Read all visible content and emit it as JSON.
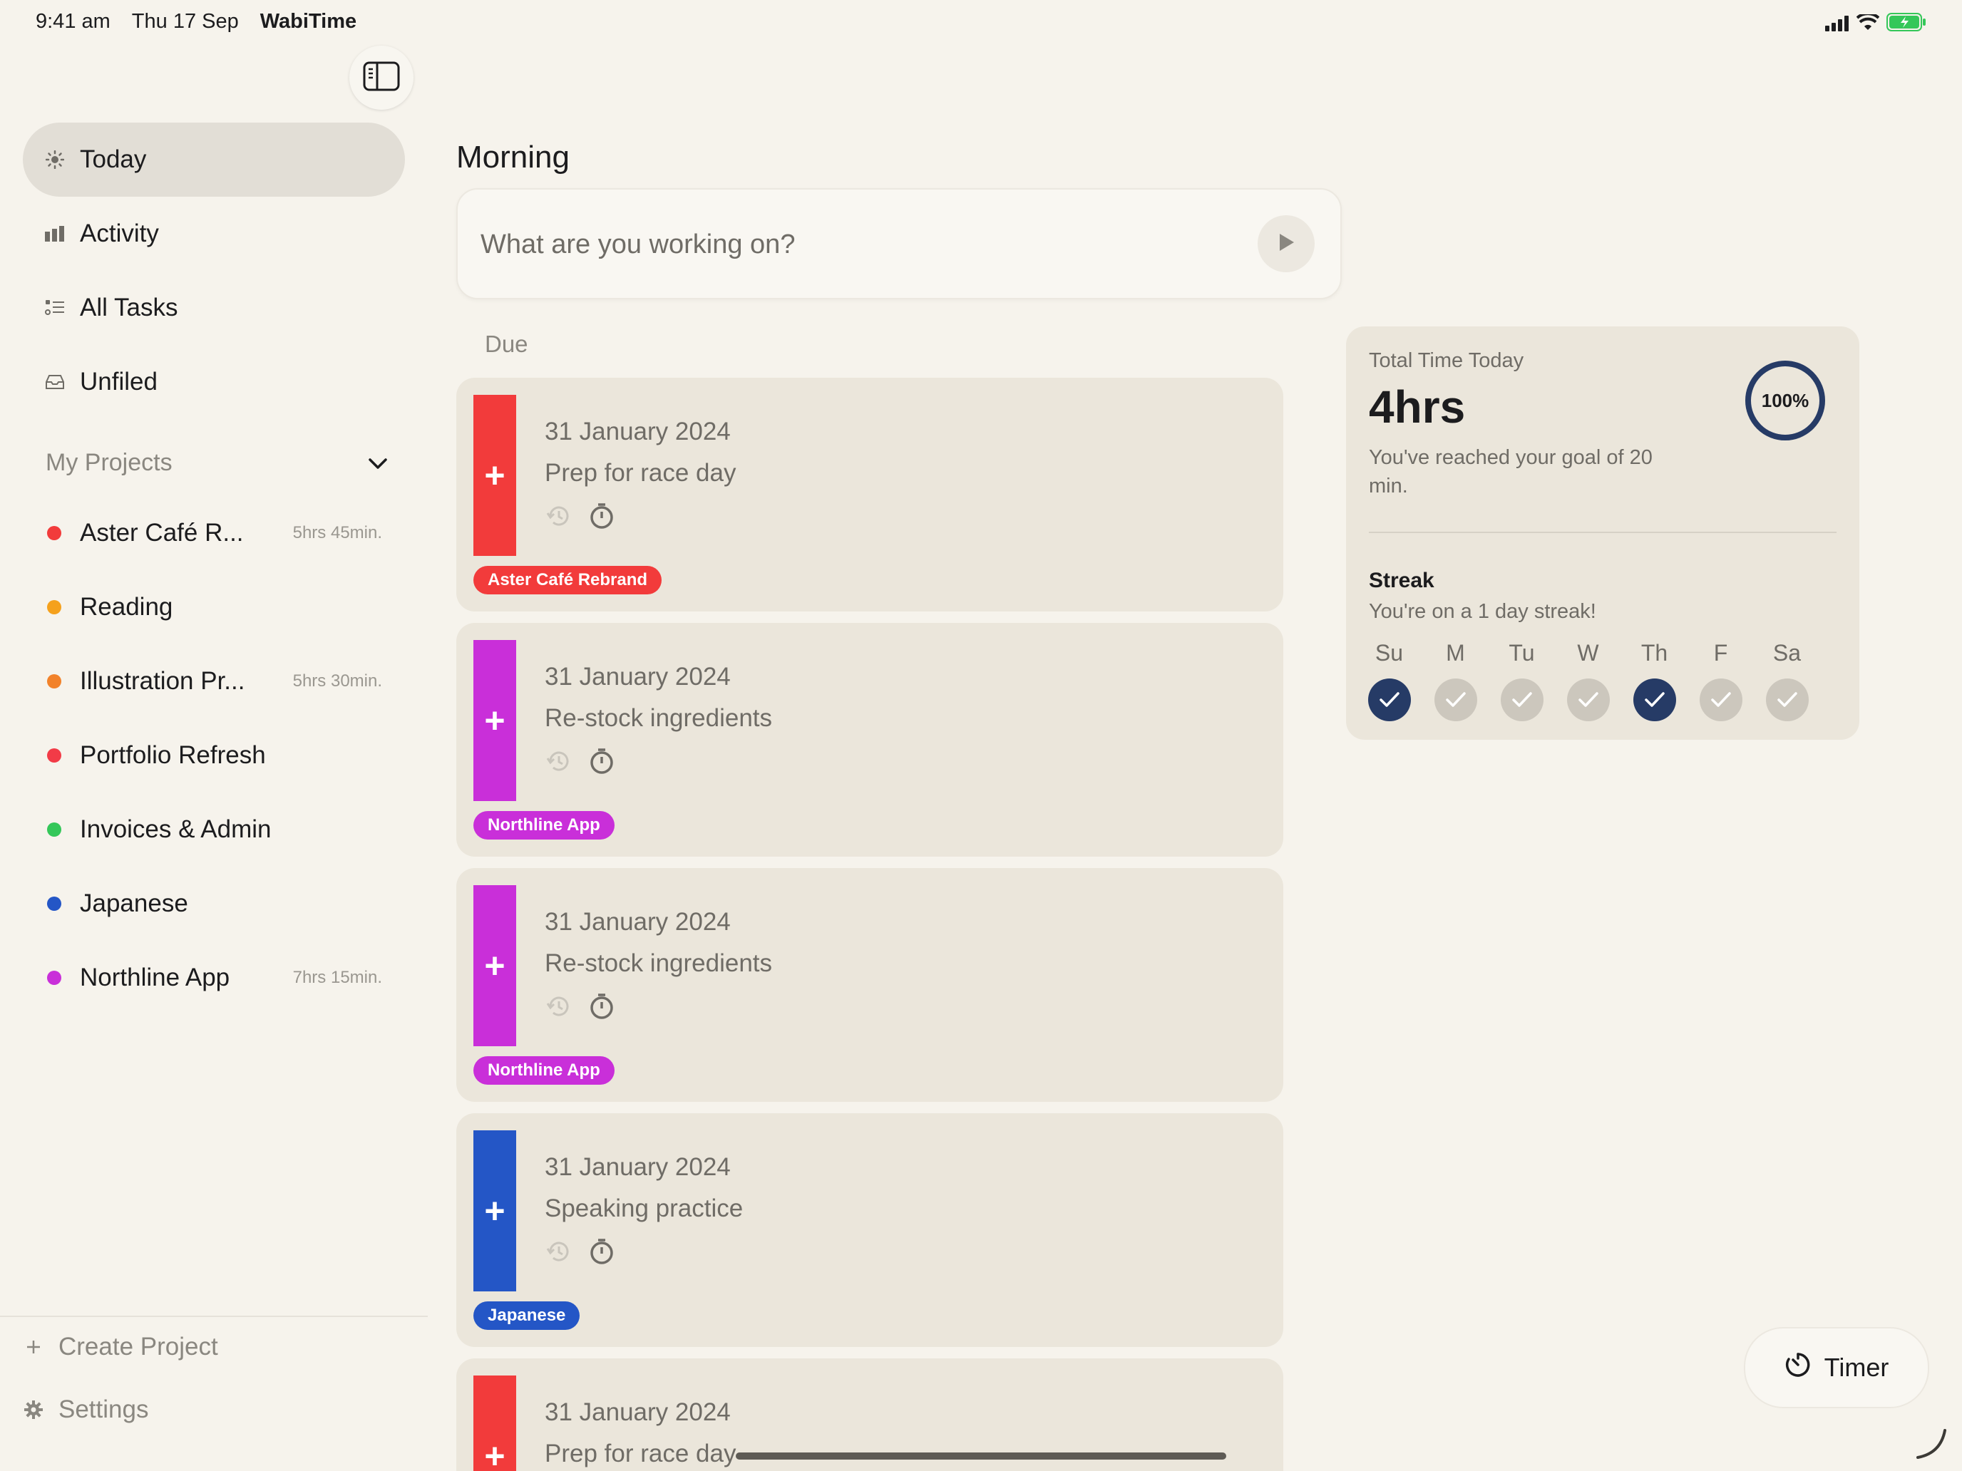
{
  "status_bar": {
    "time": "9:41 am",
    "date": "Thu 17 Sep",
    "app_name": "WabiTime"
  },
  "sidebar": {
    "nav": [
      {
        "label": "Today",
        "icon": "sun-icon",
        "active": true
      },
      {
        "label": "Activity",
        "icon": "bar-chart-icon",
        "active": false
      },
      {
        "label": "All Tasks",
        "icon": "task-list-icon",
        "active": false
      },
      {
        "label": "Unfiled",
        "icon": "inbox-icon",
        "active": false
      }
    ],
    "projects_header": "My Projects",
    "projects": [
      {
        "name": "Aster Café R...",
        "time": "5hrs 45min.",
        "color": "#F23B3B"
      },
      {
        "name": "Reading",
        "time": "",
        "color": "#F5A11C"
      },
      {
        "name": "Illustration Pr...",
        "time": "5hrs 30min.",
        "color": "#F2822A"
      },
      {
        "name": "Portfolio Refresh",
        "time": "",
        "color": "#F23B47"
      },
      {
        "name": "Invoices & Admin",
        "time": "",
        "color": "#34C759"
      },
      {
        "name": "Japanese",
        "time": "",
        "color": "#2456C6"
      },
      {
        "name": "Northline App",
        "time": "7hrs 15min.",
        "color": "#C92FD9"
      }
    ],
    "create_project": "Create Project",
    "settings": "Settings"
  },
  "main": {
    "section_title": "Morning",
    "input_placeholder": "What are you working on?",
    "due_label": "Due",
    "tasks": [
      {
        "date": "31 January 2024",
        "title": "Prep for race day",
        "tag": "Aster Café Rebrand",
        "color": "#F23B3B"
      },
      {
        "date": "31 January 2024",
        "title": "Re-stock ingredients",
        "tag": "Northline App",
        "color": "#C92FD9"
      },
      {
        "date": "31 January 2024",
        "title": "Re-stock ingredients",
        "tag": "Northline App",
        "color": "#C92FD9"
      },
      {
        "date": "31 January 2024",
        "title": "Speaking practice",
        "tag": "Japanese",
        "color": "#2456C6"
      },
      {
        "date": "31 January 2024",
        "title": "Prep for race day",
        "tag": "",
        "color": "#F23B3B"
      }
    ]
  },
  "stats": {
    "total_label": "Total Time Today",
    "total_value": "4hrs",
    "goal_text": "You've reached your goal of 20 min.",
    "goal_percent_label": "100%",
    "goal_progress": 1.0,
    "streak_title": "Streak",
    "streak_subtitle": "You're on a 1 day streak!",
    "days": [
      {
        "label": "Su",
        "done": true
      },
      {
        "label": "M",
        "done": false
      },
      {
        "label": "Tu",
        "done": false
      },
      {
        "label": "W",
        "done": false
      },
      {
        "label": "Th",
        "done": true
      },
      {
        "label": "F",
        "done": false
      },
      {
        "label": "Sa",
        "done": false
      }
    ]
  },
  "timer_button": "Timer",
  "colors": {
    "accent_navy": "#263B66",
    "background": "#F6F3EC",
    "card": "#EBE6DB"
  }
}
